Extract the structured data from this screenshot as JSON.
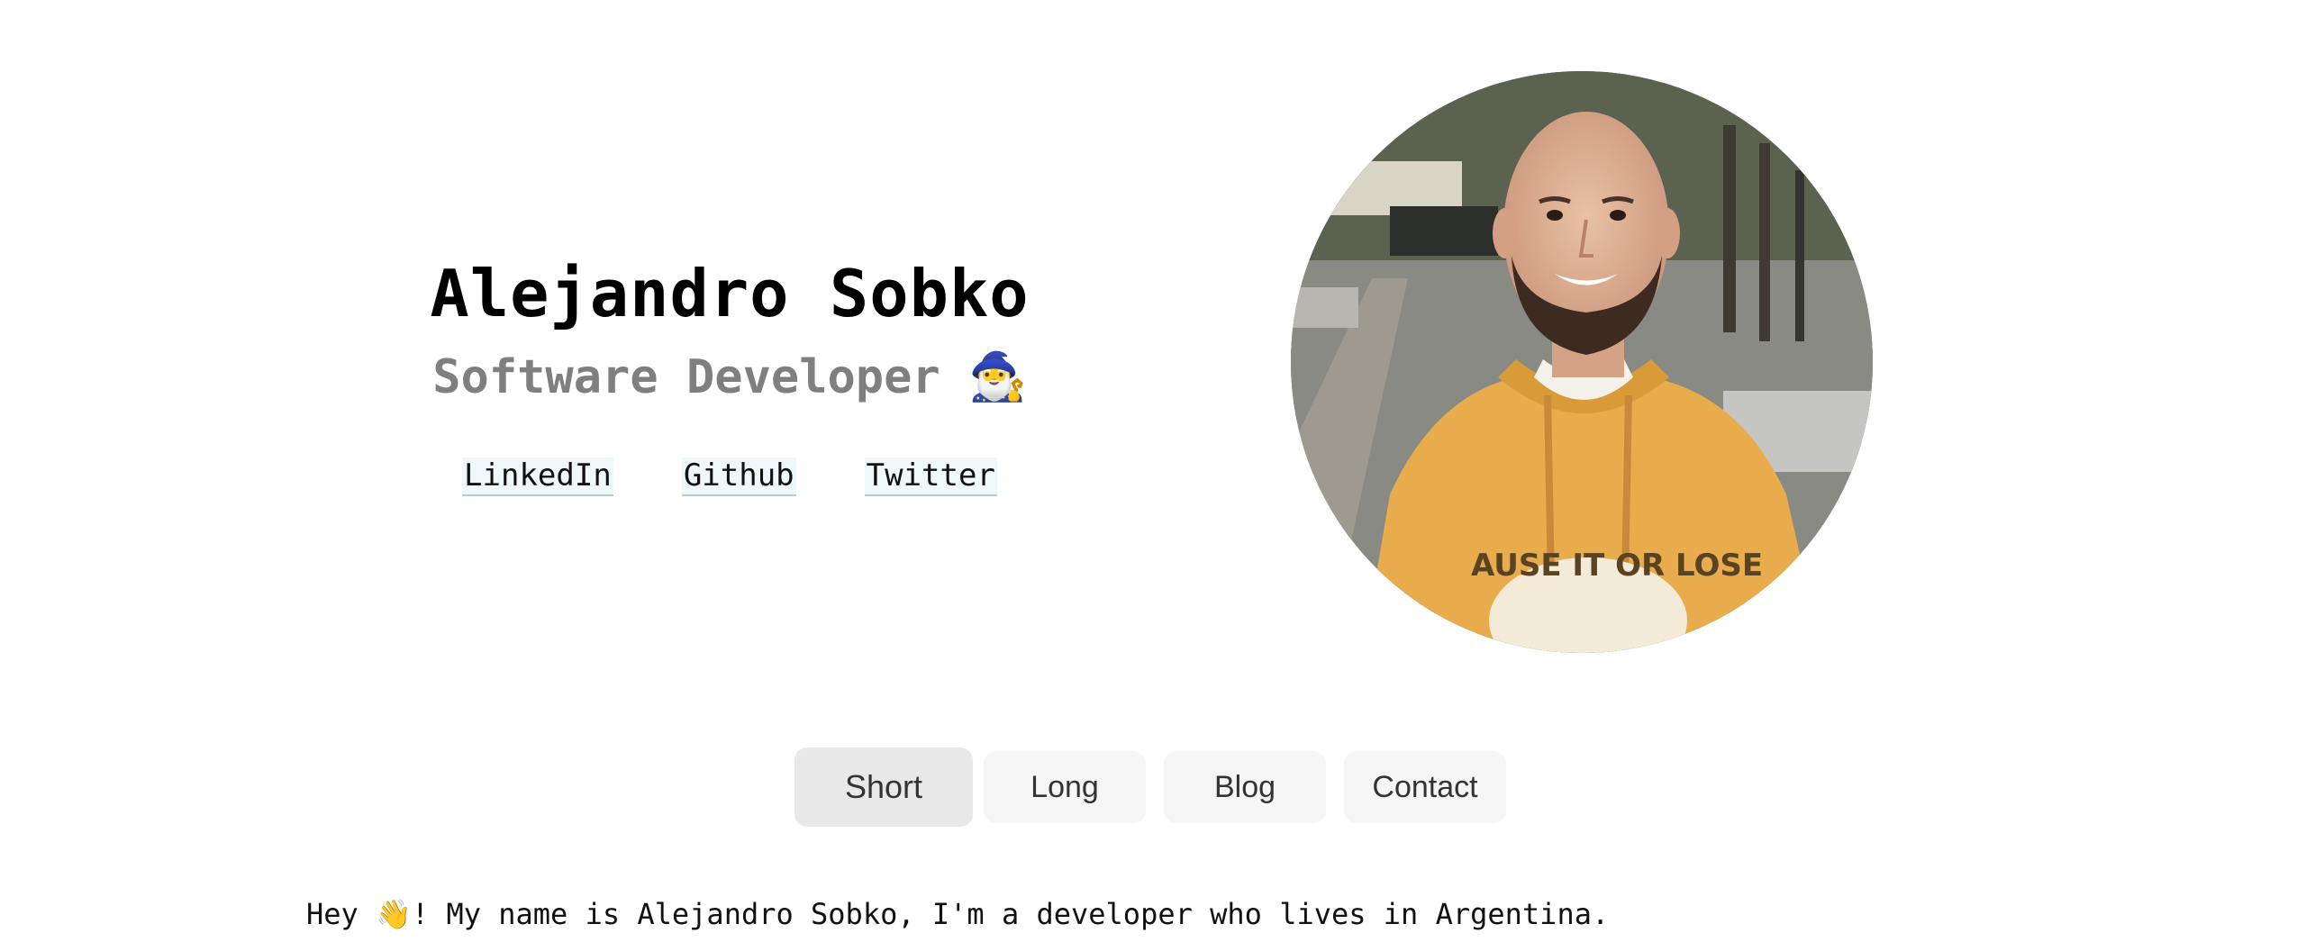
{
  "header": {
    "name": "Alejandro Sobko",
    "role": "Software Developer 🧙‍♂️"
  },
  "links": [
    {
      "label": "LinkedIn"
    },
    {
      "label": "Github"
    },
    {
      "label": "Twitter"
    }
  ],
  "avatar": {
    "alt": "Profile photo of Alejandro Sobko"
  },
  "tabs": {
    "items": [
      {
        "label": "Short",
        "active": true
      },
      {
        "label": "Long",
        "active": false
      },
      {
        "label": "Blog",
        "active": false
      },
      {
        "label": "Contact",
        "active": false
      }
    ]
  },
  "bio": {
    "text": "Hey 👋! My name is Alejandro Sobko, I'm a developer who lives in Argentina."
  },
  "colors": {
    "name": "#000000",
    "role": "#7f7f7f",
    "link_bg": "#eef8fb",
    "tab_bg": "#f5f5f5",
    "tab_active_bg": "#e8e8e8",
    "hoodie": "#e8ac4c"
  }
}
